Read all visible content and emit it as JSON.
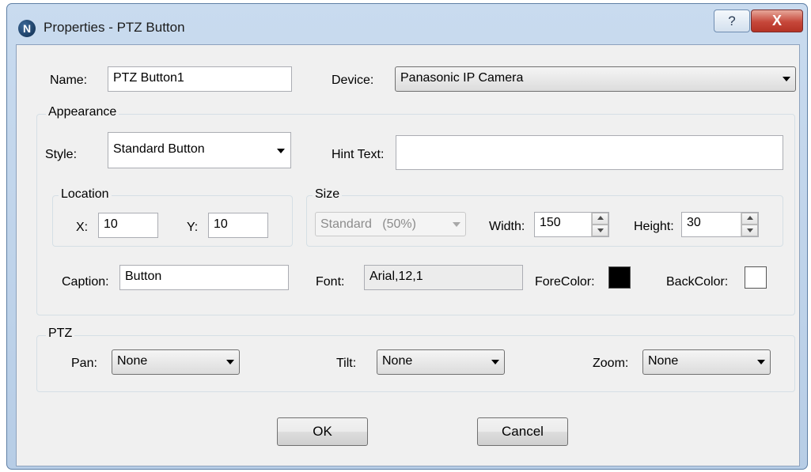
{
  "window": {
    "title": "Properties - PTZ Button",
    "app_icon_letter": "N",
    "help_glyph": "?",
    "close_glyph": "X"
  },
  "general": {
    "name_label": "Name:",
    "name_value": "PTZ Button1",
    "device_label": "Device:",
    "device_value": "Panasonic IP Camera"
  },
  "appearance": {
    "legend": "Appearance",
    "style_label": "Style:",
    "style_value": "Standard Button",
    "hint_label": "Hint Text:",
    "hint_value": "",
    "location": {
      "legend": "Location",
      "x_label": "X:",
      "x_value": "10",
      "y_label": "Y:",
      "y_value": "10"
    },
    "size": {
      "legend": "Size",
      "preset_value": "Standard   (50%)",
      "width_label": "Width:",
      "width_value": "150",
      "height_label": "Height:",
      "height_value": "30"
    },
    "caption_label": "Caption:",
    "caption_value": "Button",
    "font_label": "Font:",
    "font_value": "Arial,12,1",
    "forecolor_label": "ForeColor:",
    "forecolor": "#000000",
    "backcolor_label": "BackColor:",
    "backcolor": "#ffffff"
  },
  "ptz": {
    "legend": "PTZ",
    "pan_label": "Pan:",
    "pan_value": "None",
    "tilt_label": "Tilt:",
    "tilt_value": "None",
    "zoom_label": "Zoom:",
    "zoom_value": "None"
  },
  "buttons": {
    "ok": "OK",
    "cancel": "Cancel"
  }
}
